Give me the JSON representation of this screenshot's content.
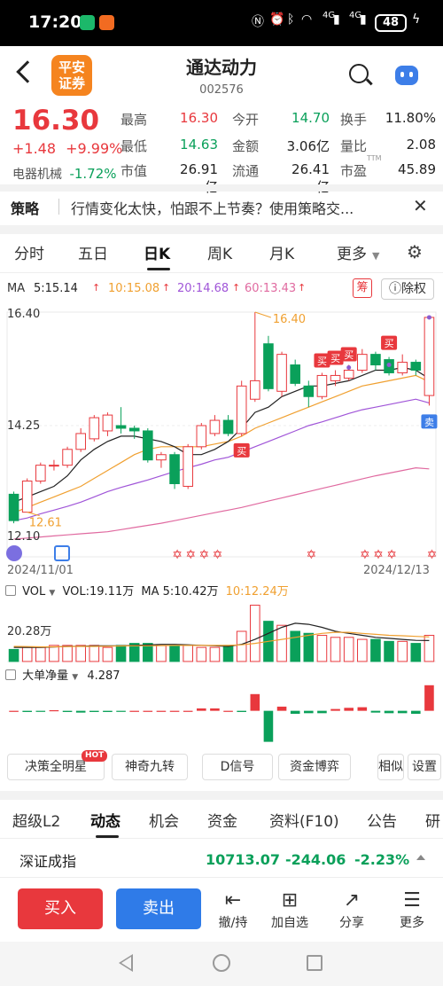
{
  "status_bar": {
    "time": "17:20",
    "signal_1": "4G",
    "signal_2": "4G",
    "battery": "48"
  },
  "header": {
    "broker_logo_text": "平安证券",
    "stock_name": "通达动力",
    "stock_code": "002576"
  },
  "quote": {
    "price": "16.30",
    "change": "+1.48",
    "change_pct": "+9.99%",
    "industry": "电器机械",
    "industry_pct": "-1.72%",
    "fields": [
      {
        "label": "最高",
        "value": "16.30",
        "color": "#e8383d"
      },
      {
        "label": "今开",
        "value": "14.70",
        "color": "#0aa05a"
      },
      {
        "label": "换手",
        "value": "11.80%",
        "color": "#222222"
      },
      {
        "label": "最低",
        "value": "14.63",
        "color": "#0aa05a"
      },
      {
        "label": "金额",
        "value": "3.06亿",
        "color": "#222222"
      },
      {
        "label": "量比",
        "value": "2.08",
        "color": "#222222"
      },
      {
        "label": "市值",
        "value": "26.91亿",
        "color": "#222222"
      },
      {
        "label": "流通",
        "value": "26.41亿",
        "color": "#222222"
      },
      {
        "label": "市盈",
        "value": "45.89",
        "color": "#222222",
        "sup": "TTM"
      }
    ]
  },
  "strategy": {
    "label": "策略",
    "text": "行情变化太快，怕跟不上节奏？使用策略交..."
  },
  "chart_tabs": [
    "分时",
    "五日",
    "日K",
    "周K",
    "月K",
    "更多"
  ],
  "active_chart_tab": "日K",
  "ma_legend": {
    "label": "MA",
    "items": [
      {
        "text": "5:15.14",
        "color": "#222222"
      },
      {
        "text": "10:15.08",
        "color": "#f0a030"
      },
      {
        "text": "20:14.68",
        "color": "#a055d8"
      },
      {
        "text": "60:13.43",
        "color": "#e06aa0"
      }
    ],
    "chou_label": "筹",
    "adjust_label": "除权"
  },
  "kline_axis": {
    "top": "16.40",
    "mid": "14.25",
    "bottom": "12.10",
    "date_start": "2024/11/01",
    "date_end": "2024/12/13",
    "high_label": "16.40",
    "low_label": "12.61",
    "buy_label": "买",
    "sell_label": "卖"
  },
  "volume": {
    "label": "VOL",
    "vol_text": "VOL:19.11万",
    "ma5_text": "MA 5:10.42万",
    "ma10_text": "10:12.24万",
    "axis_label": "20.28万"
  },
  "big_flow": {
    "label": "大单净量",
    "value": "4.287"
  },
  "indicator_buttons": {
    "hot_badge": "HOT",
    "items": [
      "决策全明星",
      "神奇九转",
      "D信号",
      "资金博弈",
      "相似",
      "设置"
    ]
  },
  "sub_tabs": [
    "超级L2",
    "动态",
    "机会",
    "资金",
    "资料(F10)",
    "公告",
    "研"
  ],
  "active_sub_tab": "动态",
  "index_ticker": {
    "name": "深证成指",
    "value": "10713.07",
    "change": "-244.06",
    "change_pct": "-2.23%"
  },
  "bottom_bar": {
    "buy_label": "买入",
    "sell_label": "卖出",
    "actions": [
      "撤/持",
      "加自选",
      "分享",
      "更多"
    ]
  },
  "colors": {
    "up": "#e8383d",
    "down": "#0aa05a",
    "buy_button": "#e8383d",
    "sell_button": "#2f7be8"
  },
  "chart_data": {
    "type": "candlestick",
    "x": [
      "2024/11/01",
      "",
      "",
      "",
      "",
      "",
      "",
      "",
      "",
      "",
      "",
      "",
      "",
      "",
      "",
      "",
      "",
      "",
      "",
      "",
      "",
      "",
      "",
      "",
      "",
      "",
      "",
      "",
      "",
      "",
      "",
      "2024/12/13"
    ],
    "candles": [
      {
        "o": 12.95,
        "c": 12.45,
        "h": 13.0,
        "l": 12.4
      },
      {
        "o": 12.61,
        "c": 13.2,
        "h": 13.25,
        "l": 12.61
      },
      {
        "o": 13.2,
        "c": 13.5,
        "h": 13.55,
        "l": 13.15
      },
      {
        "o": 13.5,
        "c": 13.5,
        "h": 13.6,
        "l": 13.4
      },
      {
        "o": 13.5,
        "c": 13.8,
        "h": 13.85,
        "l": 13.45
      },
      {
        "o": 13.8,
        "c": 14.1,
        "h": 14.2,
        "l": 13.75
      },
      {
        "o": 14.0,
        "c": 14.4,
        "h": 14.45,
        "l": 13.95
      },
      {
        "o": 14.15,
        "c": 14.45,
        "h": 14.5,
        "l": 14.05
      },
      {
        "o": 14.25,
        "c": 14.2,
        "h": 14.6,
        "l": 14.1
      },
      {
        "o": 14.2,
        "c": 14.15,
        "h": 14.25,
        "l": 14.0
      },
      {
        "o": 14.15,
        "c": 13.6,
        "h": 14.2,
        "l": 13.55
      },
      {
        "o": 13.6,
        "c": 13.7,
        "h": 13.75,
        "l": 13.45
      },
      {
        "o": 13.7,
        "c": 13.15,
        "h": 13.75,
        "l": 13.05
      },
      {
        "o": 13.1,
        "c": 13.85,
        "h": 13.9,
        "l": 13.05
      },
      {
        "o": 13.85,
        "c": 14.25,
        "h": 14.3,
        "l": 13.8
      },
      {
        "o": 14.1,
        "c": 14.35,
        "h": 14.45,
        "l": 14.05
      },
      {
        "o": 14.35,
        "c": 14.1,
        "h": 14.45,
        "l": 14.05
      },
      {
        "o": 14.1,
        "c": 15.0,
        "h": 15.1,
        "l": 14.05
      },
      {
        "o": 14.75,
        "c": 15.1,
        "h": 16.4,
        "l": 14.7
      },
      {
        "o": 15.8,
        "c": 14.95,
        "h": 15.95,
        "l": 14.9
      },
      {
        "o": 14.9,
        "c": 15.6,
        "h": 15.65,
        "l": 14.8
      },
      {
        "o": 15.4,
        "c": 15.05,
        "h": 15.5,
        "l": 15.0
      },
      {
        "o": 15.0,
        "c": 14.8,
        "h": 15.1,
        "l": 14.6
      },
      {
        "o": 14.8,
        "c": 15.2,
        "h": 15.25,
        "l": 14.75
      },
      {
        "o": 15.1,
        "c": 15.2,
        "h": 15.3,
        "l": 15.0
      },
      {
        "o": 15.15,
        "c": 15.3,
        "h": 15.4,
        "l": 15.1
      },
      {
        "o": 15.3,
        "c": 15.6,
        "h": 15.7,
        "l": 15.25
      },
      {
        "o": 15.6,
        "c": 15.4,
        "h": 15.65,
        "l": 15.3
      },
      {
        "o": 15.5,
        "c": 15.25,
        "h": 15.55,
        "l": 15.2
      },
      {
        "o": 15.25,
        "c": 15.45,
        "h": 15.6,
        "l": 15.2
      },
      {
        "o": 15.45,
        "c": 15.3,
        "h": 15.5,
        "l": 15.2
      },
      {
        "o": 14.82,
        "c": 16.3,
        "h": 16.3,
        "l": 14.63
      }
    ],
    "ma5": [
      12.8,
      12.9,
      13.0,
      13.1,
      13.3,
      13.6,
      13.8,
      13.95,
      14.05,
      14.05,
      14.0,
      13.95,
      13.85,
      13.7,
      13.7,
      13.8,
      13.95,
      14.2,
      14.5,
      14.6,
      14.8,
      14.9,
      15.0,
      15.0,
      15.05,
      15.1,
      15.2,
      15.3,
      15.3,
      15.35,
      15.3,
      15.14
    ],
    "ma10": [
      12.6,
      12.7,
      12.8,
      12.9,
      13.0,
      13.1,
      13.25,
      13.4,
      13.55,
      13.7,
      13.8,
      13.85,
      13.85,
      13.85,
      13.85,
      13.9,
      13.95,
      14.05,
      14.2,
      14.3,
      14.4,
      14.5,
      14.6,
      14.7,
      14.8,
      14.9,
      15.0,
      15.05,
      15.1,
      15.15,
      15.2,
      15.08
    ],
    "ma20": [
      12.45,
      12.5,
      12.58,
      12.65,
      12.72,
      12.8,
      12.9,
      13.0,
      13.08,
      13.15,
      13.22,
      13.3,
      13.38,
      13.45,
      13.52,
      13.6,
      13.65,
      13.75,
      13.85,
      13.95,
      14.05,
      14.15,
      14.25,
      14.32,
      14.4,
      14.48,
      14.55,
      14.6,
      14.65,
      14.7,
      14.75,
      14.68
    ],
    "ma60": [
      12.1,
      12.12,
      12.14,
      12.16,
      12.18,
      12.2,
      12.22,
      12.24,
      12.28,
      12.32,
      12.36,
      12.4,
      12.45,
      12.5,
      12.55,
      12.6,
      12.65,
      12.7,
      12.76,
      12.82,
      12.88,
      12.94,
      13.0,
      13.06,
      13.12,
      13.18,
      13.24,
      13.3,
      13.35,
      13.4,
      13.45,
      13.43
    ],
    "ylim": [
      12.1,
      16.4
    ],
    "volume": [
      6,
      7,
      7,
      8,
      8,
      8,
      8,
      7,
      8,
      9,
      9,
      8,
      8,
      8,
      7,
      7,
      8,
      15,
      28,
      20,
      18,
      15,
      14,
      13,
      12,
      12,
      11,
      11,
      10,
      10,
      9,
      13
    ],
    "volume_ma5": [
      7,
      7,
      7,
      7.2,
      7.5,
      7.6,
      7.8,
      7.8,
      7.8,
      8,
      8.2,
      8.5,
      8.5,
      8.3,
      8,
      7.8,
      7.5,
      8.5,
      11,
      14,
      17,
      19,
      18.5,
      17,
      15,
      14,
      13,
      12,
      11.5,
      11,
      10.5,
      10.42
    ],
    "volume_ma10": [
      7.5,
      7.4,
      7.3,
      7.3,
      7.4,
      7.5,
      7.5,
      7.6,
      7.7,
      7.8,
      7.8,
      7.9,
      8,
      8,
      8,
      8,
      8,
      8.3,
      9,
      10,
      11,
      12,
      13,
      14,
      14.5,
      14.5,
      14,
      13.5,
      13,
      12.8,
      12.5,
      12.24
    ],
    "volume_ylim": [
      0,
      30
    ],
    "big_flow": [
      0,
      -0.2,
      -0.1,
      0.1,
      -0.2,
      -0.3,
      -0.2,
      -0.2,
      -0.1,
      0,
      0,
      0,
      0,
      0,
      0.4,
      0.4,
      0,
      -0.2,
      2.8,
      -5.2,
      0.7,
      -0.5,
      -0.4,
      -0.4,
      0.3,
      0.5,
      0.6,
      -0.3,
      -0.4,
      -0.4,
      -0.5,
      4.287
    ],
    "big_flow_ylim": [
      -6,
      5
    ]
  }
}
